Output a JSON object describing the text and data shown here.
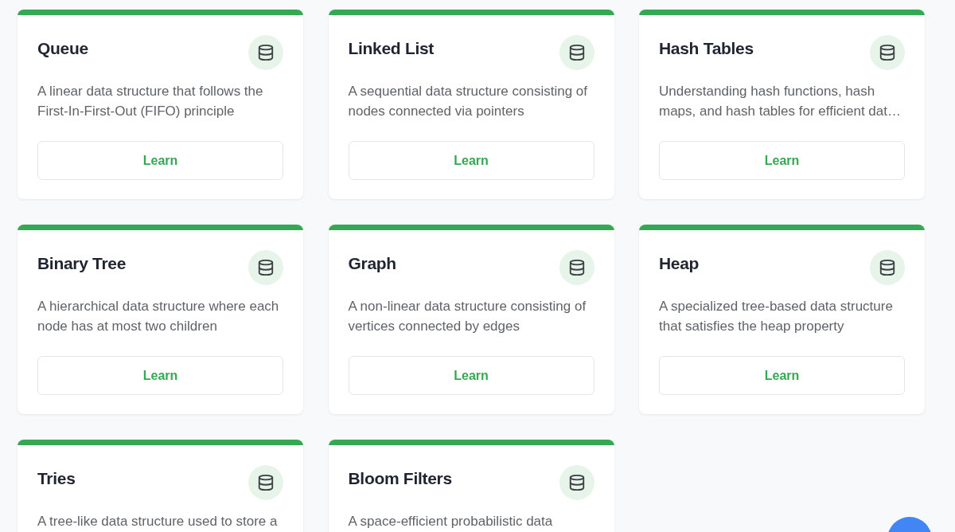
{
  "cards": [
    {
      "title": "Queue",
      "description": "A linear data structure that follows the First-In-First-Out (FIFO) principle",
      "button": "Learn"
    },
    {
      "title": "Linked List",
      "description": "A sequential data structure consisting of nodes connected via pointers",
      "button": "Learn"
    },
    {
      "title": "Hash Tables",
      "description": "Understanding hash functions, hash maps, and hash tables for efficient dat…",
      "button": "Learn"
    },
    {
      "title": "Binary Tree",
      "description": "A hierarchical data structure where each node has at most two children",
      "button": "Learn"
    },
    {
      "title": "Graph",
      "description": "A non-linear data structure consisting of vertices connected by edges",
      "button": "Learn"
    },
    {
      "title": "Heap",
      "description": "A specialized tree-based data structure that satisfies the heap property",
      "button": "Learn"
    },
    {
      "title": "Tries",
      "description": "A tree-like data structure used to store a"
    },
    {
      "title": "Bloom Filters",
      "description": "A space-efficient probabilistic data"
    }
  ]
}
